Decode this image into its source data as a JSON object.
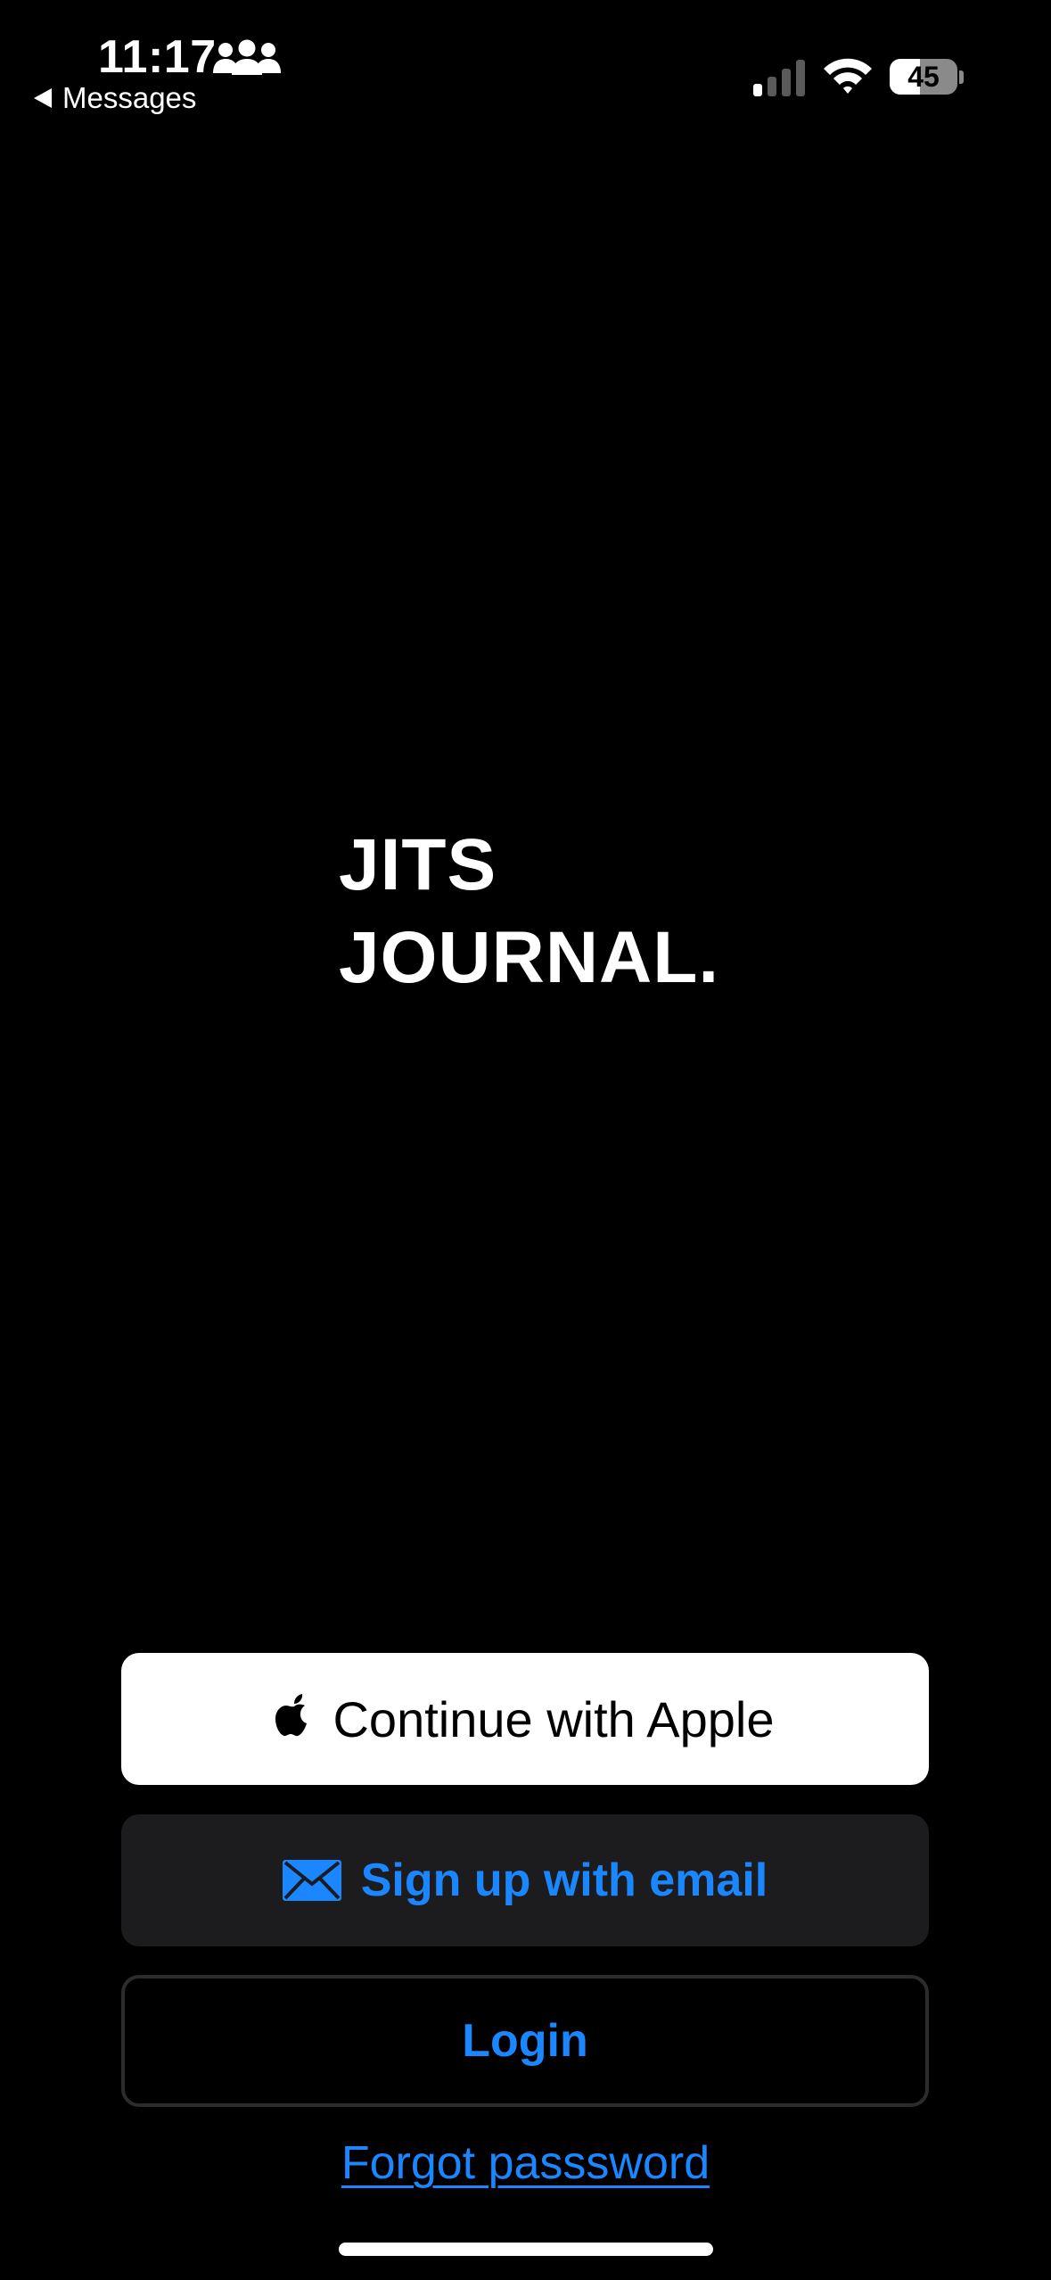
{
  "status_bar": {
    "time": "11:17",
    "back_label": "Messages",
    "battery_text": "45",
    "battery_level_percent": 45,
    "signal_bars_active": 1,
    "signal_bars_total": 4,
    "icons": [
      "people-icon",
      "cellular-signal-icon",
      "wifi-icon",
      "battery-icon"
    ]
  },
  "logo": {
    "line1": "JITS",
    "line2": "JOURNAL."
  },
  "buttons": {
    "apple": {
      "label": "Continue with Apple",
      "icon": "apple-icon"
    },
    "email": {
      "label": "Sign up with email",
      "icon": "mail-icon"
    },
    "login": {
      "label": "Login"
    }
  },
  "forgot_password": {
    "label": "Forgot passsword"
  },
  "colors": {
    "background": "#000000",
    "accent": "#1a86ff",
    "secondary_button": "#1c1c1e"
  }
}
